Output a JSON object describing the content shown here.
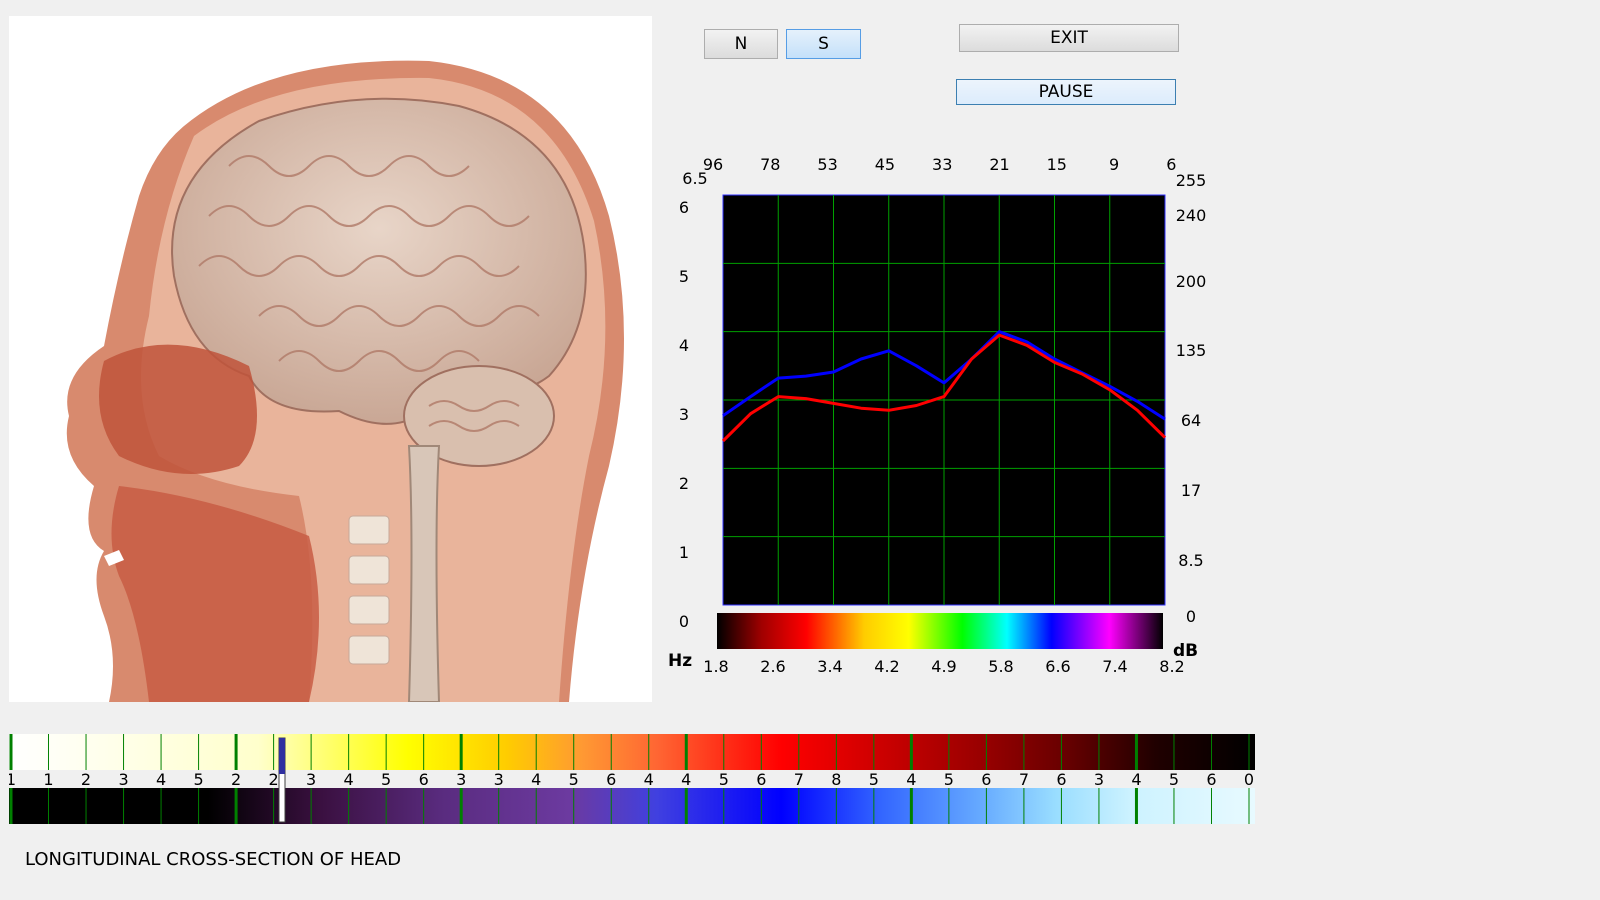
{
  "buttons": {
    "n_label": "N",
    "s_label": "S",
    "exit_label": "EXIT",
    "pause_label": "PAUSE"
  },
  "image": {
    "description_icon": "head-cross-section-image"
  },
  "caption": "LONGITUDINAL CROSS-SECTION OF HEAD",
  "chart_data": {
    "type": "line",
    "top_axis_labels": [
      "96",
      "78",
      "53",
      "45",
      "33",
      "21",
      "15",
      "9",
      "6"
    ],
    "left_axis_labels": [
      "6.5",
      "6",
      "5",
      "4",
      "3",
      "2",
      "1",
      "0"
    ],
    "right_axis_labels": [
      "255",
      "240",
      "200",
      "135",
      "64",
      "17",
      "8.5",
      "0"
    ],
    "bottom_axis_labels": [
      "1.8",
      "2.6",
      "3.4",
      "4.2",
      "4.9",
      "5.8",
      "6.6",
      "7.4",
      "8.2"
    ],
    "bottom_unit_left": "Hz",
    "bottom_unit_right": "dB",
    "ylim": [
      0,
      6
    ],
    "x": [
      0,
      0.5,
      1,
      1.5,
      2,
      2.5,
      3,
      3.5,
      4,
      4.5,
      5,
      5.5,
      6,
      6.5,
      7,
      7.5,
      8
    ],
    "series": [
      {
        "color": "#0000ff",
        "values": [
          2.77,
          3.05,
          3.32,
          3.35,
          3.41,
          3.6,
          3.72,
          3.5,
          3.25,
          3.6,
          4.0,
          3.85,
          3.6,
          3.4,
          3.2,
          2.98,
          2.72
        ]
      },
      {
        "color": "#ff0000",
        "values": [
          2.4,
          2.8,
          3.05,
          3.02,
          2.95,
          2.88,
          2.85,
          2.92,
          3.05,
          3.6,
          3.95,
          3.8,
          3.55,
          3.38,
          3.15,
          2.85,
          2.45
        ]
      }
    ],
    "grid": true,
    "background": "#000000",
    "grid_color": "#00a000"
  },
  "scale_bar": {
    "labels": [
      "1",
      "1",
      "2",
      "3",
      "4",
      "5",
      "2",
      "2",
      "3",
      "4",
      "5",
      "6",
      "3",
      "3",
      "4",
      "5",
      "6",
      "4",
      "4",
      "5",
      "6",
      "7",
      "8",
      "5",
      "4",
      "5",
      "6",
      "7",
      "6",
      "3",
      "4",
      "5",
      "6",
      "0"
    ],
    "slider_value_label": "3"
  }
}
